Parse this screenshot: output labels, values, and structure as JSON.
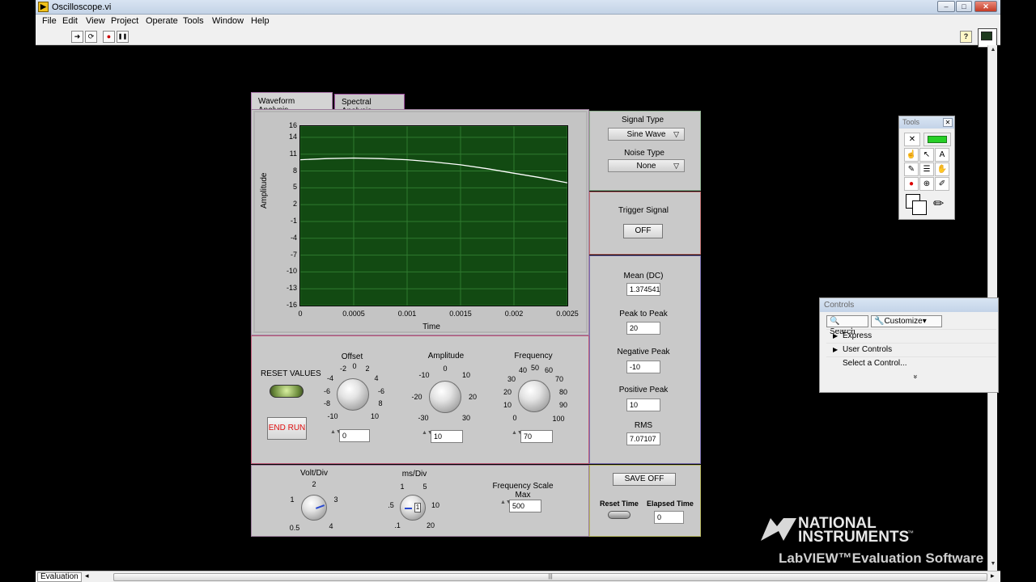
{
  "window": {
    "title": "Oscilloscope.vi",
    "min": "–",
    "max": "□",
    "close": "✕"
  },
  "menu": [
    "File",
    "Edit",
    "View",
    "Project",
    "Operate",
    "Tools",
    "Window",
    "Help"
  ],
  "toolbar": {
    "run": "➜",
    "run_continuous": "⟳",
    "abort": "●",
    "pause": "❚❚",
    "help": "?"
  },
  "tabs": [
    {
      "label": "Waveform Analysis",
      "active": true
    },
    {
      "label": "Spectral Analysis",
      "active": false
    }
  ],
  "chart_data": {
    "type": "line",
    "xlabel": "Time",
    "ylabel": "Amplitude",
    "xlim": [
      0,
      0.0025
    ],
    "ylim": [
      -16,
      16
    ],
    "yticks": [
      "16",
      "14",
      "11",
      "8",
      "5",
      "2",
      "-1",
      "-4",
      "-7",
      "-10",
      "-13",
      "-16"
    ],
    "xticks": [
      "0",
      "0.0005",
      "0.001",
      "0.0015",
      "0.002",
      "0.0025"
    ],
    "grid": true,
    "series": [
      {
        "x": [
          0,
          0.00025,
          0.0005,
          0.00075,
          0.001,
          0.00125,
          0.0015,
          0.00175,
          0.002,
          0.00225,
          0.0025
        ],
        "y": [
          10,
          10.2,
          10.3,
          10.2,
          10,
          9.6,
          9.1,
          8.4,
          7.6,
          6.8,
          5.9
        ]
      }
    ]
  },
  "signal": {
    "type_label": "Signal Type",
    "type_value": "Sine Wave",
    "noise_label": "Noise Type",
    "noise_value": "None",
    "ring_caret": "▽"
  },
  "trigger": {
    "label": "Trigger Signal",
    "button": "OFF"
  },
  "measurements": {
    "mean_label": "Mean (DC)",
    "mean_value": "1.374541",
    "p2p_label": "Peak to Peak",
    "p2p_value": "20",
    "neg_label": "Negative Peak",
    "neg_value": "-10",
    "pos_label": "Positive Peak",
    "pos_value": "10",
    "rms_label": "RMS",
    "rms_value": "7.07107"
  },
  "controls_panel": {
    "reset_label": "RESET VALUES",
    "end_run": "END RUN",
    "offset": {
      "label": "Offset",
      "ticks": [
        "-2",
        "0",
        "2",
        "-4",
        "4",
        "-6",
        "-6",
        "-8",
        "8",
        "-10",
        "10"
      ],
      "value": "0"
    },
    "amplitude": {
      "label": "Amplitude",
      "ticks": [
        "-10",
        "0",
        "10",
        "-20",
        "20",
        "-30",
        "30"
      ],
      "value": "10"
    },
    "frequency": {
      "label": "Frequency",
      "ticks": [
        "40",
        "50",
        "60",
        "30",
        "70",
        "20",
        "80",
        "10",
        "90",
        "0",
        "100"
      ],
      "value": "70"
    },
    "spin_arrows": "▲▼"
  },
  "scale_panel": {
    "volt_div": {
      "label": "Volt/Div",
      "ticks": [
        "2",
        "1",
        "3",
        "0.5",
        "4"
      ]
    },
    "ms_div": {
      "label": "ms/Div",
      "ticks": [
        "1",
        "5",
        ".5",
        "10",
        ".1",
        "20"
      ],
      "value": "1"
    },
    "freq_max": {
      "label": "Frequency Scale Max",
      "value": "500"
    }
  },
  "save_panel": {
    "save": "SAVE OFF",
    "reset_time": "Reset Time",
    "elapsed_label": "Elapsed Time",
    "elapsed_value": "0"
  },
  "tools_palette": {
    "title": "Tools",
    "close": "✕"
  },
  "controls_palette": {
    "title": "Controls",
    "search": "Search",
    "customize": "Customize▾",
    "items": [
      "Express",
      "User Controls",
      "Select a Control..."
    ],
    "more": "»"
  },
  "status": {
    "mode": "Evaluation",
    "left_arrow": "◂",
    "right_arrow": "▸",
    "thumb_grip": "|||"
  },
  "logo": {
    "line1": "NATIONAL",
    "line2": "INSTRUMENTS",
    "tm": "™",
    "line3": "LabVIEW™Evaluation Software"
  }
}
